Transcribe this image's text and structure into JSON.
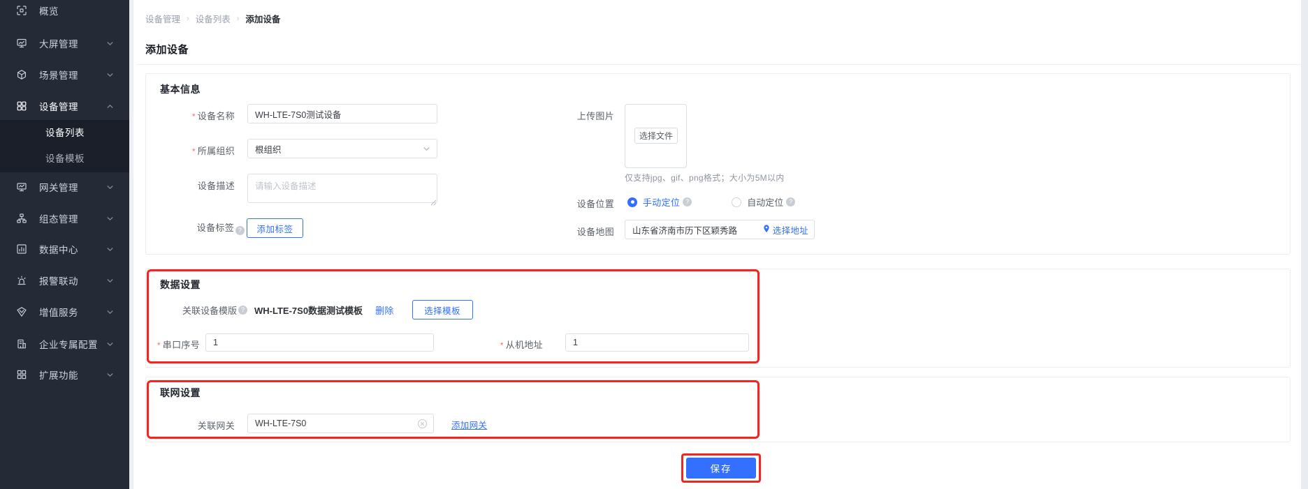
{
  "colors": {
    "accent": "#3370ff",
    "annotation_red": "#f5241f",
    "sidebar_bg": "#252a37",
    "submenu_bg": "#1a1f2a"
  },
  "form": {
    "required_mark": "*"
  },
  "sidebar": {
    "items": [
      {
        "label": "概览",
        "icon": "overview-icon"
      },
      {
        "label": "大屏管理",
        "icon": "screen-icon",
        "chevron": "down"
      },
      {
        "label": "场景管理",
        "icon": "scene-icon",
        "chevron": "down"
      },
      {
        "label": "设备管理",
        "icon": "device-icon",
        "chevron": "up",
        "active": true
      },
      {
        "label": "网关管理",
        "icon": "gateway-icon",
        "chevron": "down"
      },
      {
        "label": "组态管理",
        "icon": "topology-icon",
        "chevron": "down"
      },
      {
        "label": "数据中心",
        "icon": "data-center-icon",
        "chevron": "down"
      },
      {
        "label": "报警联动",
        "icon": "alarm-icon",
        "chevron": "down"
      },
      {
        "label": "增值服务",
        "icon": "value-service-icon",
        "chevron": "down"
      },
      {
        "label": "企业专属配置",
        "icon": "enterprise-icon",
        "chevron": "down"
      },
      {
        "label": "扩展功能",
        "icon": "extension-icon",
        "chevron": "down"
      }
    ],
    "submenu": [
      {
        "label": "设备列表",
        "active": true
      },
      {
        "label": "设备模板",
        "active": false
      }
    ]
  },
  "breadcrumb": {
    "part1": "设备管理",
    "part2": "设备列表",
    "part3": "添加设备",
    "separator": "›"
  },
  "page": {
    "title": "添加设备"
  },
  "basic": {
    "title": "基本信息",
    "name": {
      "label": "设备名称",
      "value": "WH-LTE-7S0测试设备"
    },
    "org": {
      "label": "所属组织",
      "value": "根组织"
    },
    "desc": {
      "label": "设备描述",
      "placeholder": "请输入设备描述"
    },
    "tag": {
      "label": "设备标签",
      "button": "添加标签"
    },
    "upload": {
      "label": "上传图片",
      "button": "选择文件",
      "hint": "仅支持jpg、gif、png格式；大小为5M以内"
    },
    "location": {
      "label": "设备位置",
      "manual": "手动定位",
      "auto": "自动定位"
    },
    "map": {
      "label": "设备地图",
      "value": "山东省济南市历下区颖秀路",
      "link": "选择地址"
    }
  },
  "data_section": {
    "title": "数据设置",
    "template": {
      "label": "关联设备模版",
      "value": "WH-LTE-7S0数据测试模板",
      "delete_link": "删除",
      "select_button": "选择模板"
    },
    "serial": {
      "label": "串口序号",
      "value": "1"
    },
    "slave": {
      "label": "从机地址",
      "value": "1"
    }
  },
  "network_section": {
    "title": "联网设置",
    "gateway": {
      "label": "关联网关",
      "value": "WH-LTE-7S0",
      "add_link": "添加网关"
    }
  },
  "footer": {
    "save": "保存"
  }
}
